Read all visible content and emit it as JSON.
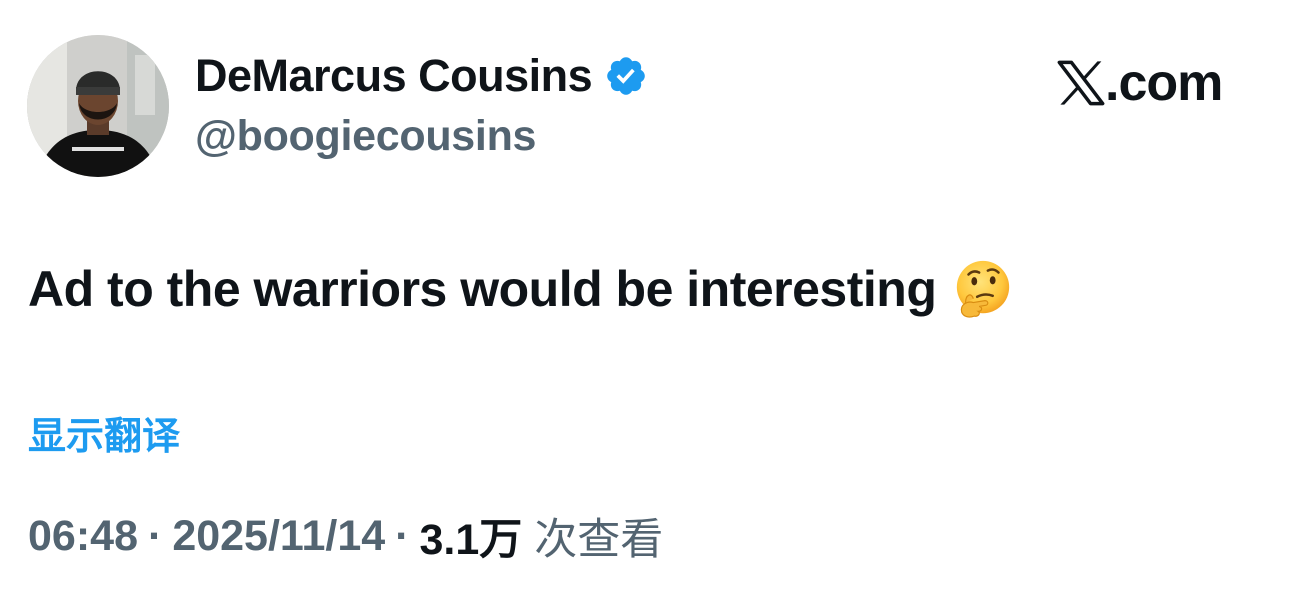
{
  "tweet": {
    "author": {
      "display_name": "DeMarcus Cousins",
      "handle": "@boogiecousins",
      "verified": true,
      "verified_color": "#1d9bf0"
    },
    "brand": {
      "text": ".com",
      "icon": "x-logo-icon"
    },
    "text": "Ad to the warriors would be interesting",
    "emoji": "thinking-face",
    "translate_label": "显示翻译",
    "meta": {
      "time": "06:48",
      "separator": "·",
      "date": "2025/11/14",
      "views_count": "3.1万",
      "views_label": "次查看"
    }
  }
}
